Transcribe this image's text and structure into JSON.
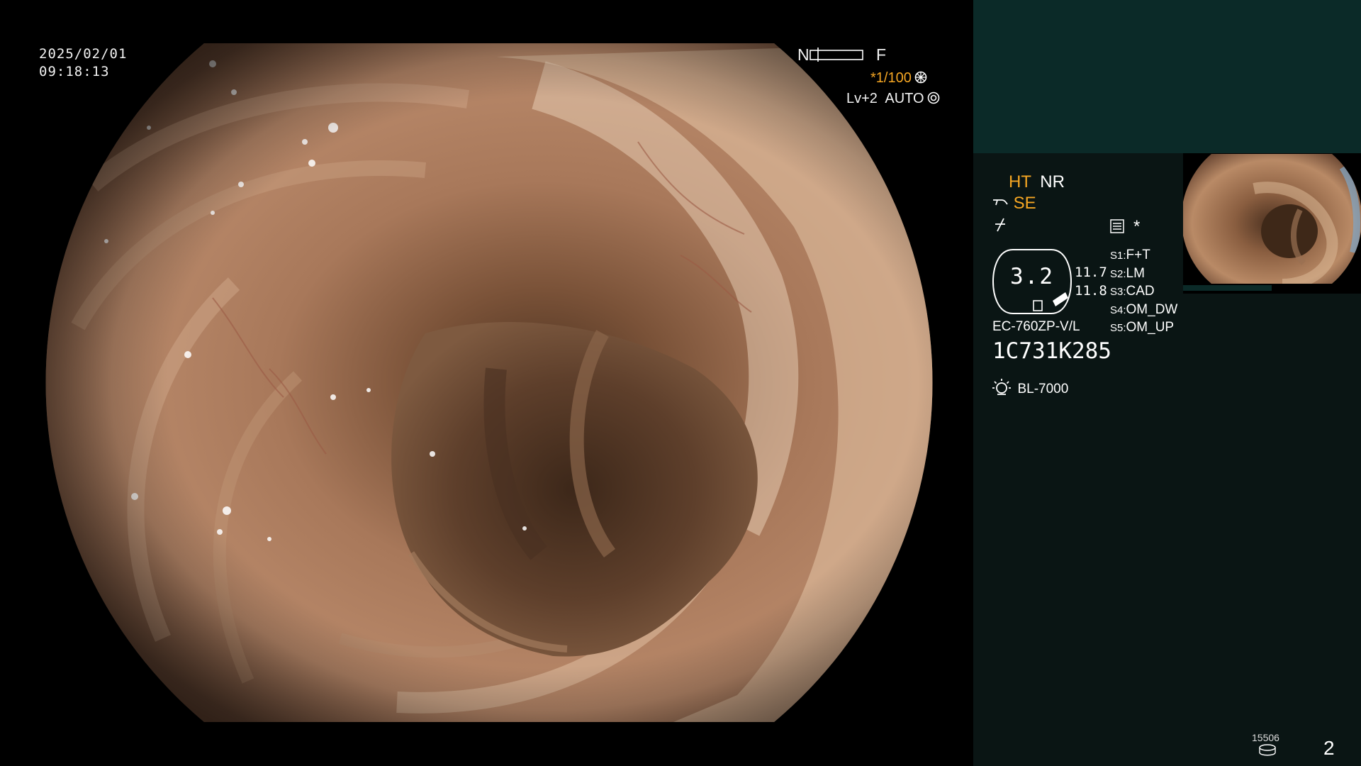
{
  "overlay": {
    "date": "2025/02/01",
    "time": "09:18:13",
    "focus_near": "N",
    "focus_far": "F",
    "shutter": "*1/100",
    "enhance_level": "Lv+2",
    "iris_mode": "AUTO"
  },
  "panel": {
    "ht_label": "HT",
    "nr_label": "NR",
    "se_label": "SE",
    "star_label": "*",
    "zoom_value": "3.2",
    "value_upper": "11.7",
    "value_lower": "11.8",
    "scope_model": "EC-760ZP-V/L",
    "scope_serial": "1C731K285",
    "light_source": "BL-7000",
    "presets": [
      {
        "key": "S1",
        "value": "F+T"
      },
      {
        "key": "S2",
        "value": "LM"
      },
      {
        "key": "S3",
        "value": "CAD"
      },
      {
        "key": "S4",
        "value": "OM_DW"
      },
      {
        "key": "S5",
        "value": "OM_UP"
      }
    ],
    "storage_count": "15506",
    "page_number": "2"
  },
  "colors": {
    "panel_bg": "#0a1514",
    "panel_top": "#0b2a28",
    "accent_orange": "#f5a623",
    "text": "#ffffff"
  },
  "icons": {
    "shutter": "gear-icon",
    "iris": "iris-icon",
    "se_prefix": "scope-tip-icon",
    "edge": "edge-icon",
    "recorder": "recorder-icon",
    "light": "lamp-icon",
    "storage": "disk-icon"
  }
}
